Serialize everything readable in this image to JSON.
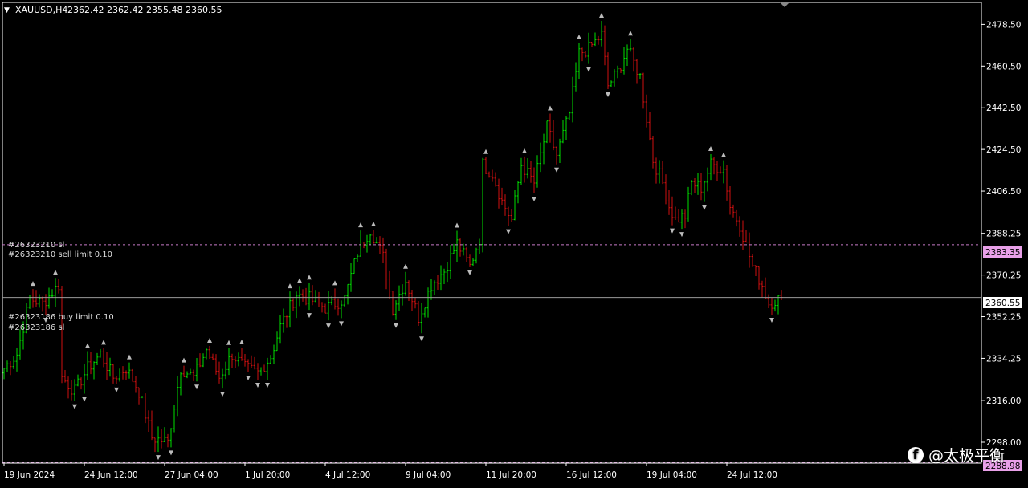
{
  "header": {
    "symbol": "XAUUSD,H4",
    "ohlc": "2362.42 2362.42 2355.48 2360.55"
  },
  "orders": [
    {
      "label": "#26323210 sl",
      "price": 2383.35
    },
    {
      "label": "#26323210 sell limit 0.10",
      "price": 2383.35
    },
    {
      "label": "#26323186 buy limit 0.10",
      "price": 2360.55
    },
    {
      "label": "#26323186 sl",
      "price": 2360.55
    }
  ],
  "price_tags": {
    "order_line": "2383.35",
    "bid_line": "2360.55",
    "bottom": "2288.98"
  },
  "watermark": {
    "icon": "facebook-icon",
    "text": "@太极平衡"
  },
  "colors": {
    "bull": "#00e000",
    "bear": "#d01010",
    "order_line": "#c87ac8",
    "bid_line": "#9a9a9a",
    "tag_pink": "#e8a0e8"
  },
  "chart_data": {
    "type": "candlestick",
    "symbol": "XAUUSD",
    "timeframe": "H4",
    "y_range": [
      2288.98,
      2488
    ],
    "y_ticks": [
      2298.0,
      2316.0,
      2334.25,
      2352.25,
      2370.25,
      2388.25,
      2406.5,
      2424.5,
      2442.5,
      2460.5,
      2478.5
    ],
    "y_tick_labels": [
      "2298.00",
      "2316.00",
      "2334.25",
      "2352.25",
      "2370.25",
      "2388.25",
      "2406.50",
      "2424.50",
      "2442.50",
      "2460.50",
      "2478.50"
    ],
    "x_labels": [
      "19 Jun 2024",
      "24 Jun 12:00",
      "27 Jun 04:00",
      "1 Jul 20:00",
      "4 Jul 12:00",
      "9 Jul 04:00",
      "11 Jul 20:00",
      "16 Jul 12:00",
      "19 Jul 04:00",
      "24 Jul 12:00"
    ],
    "x_label_index": [
      0,
      25,
      50,
      75,
      100,
      125,
      150,
      175,
      200,
      225
    ],
    "bar_count": 243,
    "anchor_prices": [
      [
        0,
        2330
      ],
      [
        4,
        2336
      ],
      [
        8,
        2360
      ],
      [
        12,
        2358
      ],
      [
        17,
        2366
      ],
      [
        18,
        2326
      ],
      [
        22,
        2320
      ],
      [
        26,
        2330
      ],
      [
        30,
        2336
      ],
      [
        34,
        2326
      ],
      [
        38,
        2330
      ],
      [
        42,
        2320
      ],
      [
        46,
        2300
      ],
      [
        51,
        2298
      ],
      [
        55,
        2330
      ],
      [
        59,
        2326
      ],
      [
        63,
        2338
      ],
      [
        67,
        2326
      ],
      [
        71,
        2336
      ],
      [
        75,
        2330
      ],
      [
        79,
        2328
      ],
      [
        83,
        2335
      ],
      [
        86,
        2348
      ],
      [
        91,
        2362
      ],
      [
        95,
        2360
      ],
      [
        100,
        2356
      ],
      [
        106,
        2360
      ],
      [
        110,
        2380
      ],
      [
        114,
        2390
      ],
      [
        118,
        2378
      ],
      [
        121,
        2356
      ],
      [
        125,
        2368
      ],
      [
        129,
        2352
      ],
      [
        133,
        2366
      ],
      [
        137,
        2372
      ],
      [
        141,
        2384
      ],
      [
        145,
        2374
      ],
      [
        148,
        2386
      ],
      [
        149,
        2418
      ],
      [
        152,
        2414
      ],
      [
        155,
        2402
      ],
      [
        158,
        2394
      ],
      [
        161,
        2418
      ],
      [
        165,
        2410
      ],
      [
        169,
        2434
      ],
      [
        172,
        2422
      ],
      [
        176,
        2440
      ],
      [
        179,
        2466
      ],
      [
        182,
        2468
      ],
      [
        186,
        2474
      ],
      [
        188,
        2452
      ],
      [
        191,
        2458
      ],
      [
        194,
        2468
      ],
      [
        198,
        2456
      ],
      [
        202,
        2420
      ],
      [
        205,
        2410
      ],
      [
        207,
        2400
      ],
      [
        209,
        2394
      ],
      [
        212,
        2396
      ],
      [
        214,
        2410
      ],
      [
        217,
        2408
      ],
      [
        220,
        2418
      ],
      [
        224,
        2416
      ],
      [
        226,
        2400
      ],
      [
        229,
        2392
      ],
      [
        233,
        2374
      ],
      [
        236,
        2366
      ],
      [
        238,
        2358
      ],
      [
        241,
        2360
      ],
      [
        242,
        2360.55
      ]
    ],
    "order_lines": [
      {
        "price": 2383.35,
        "style": "dashed"
      },
      {
        "price": 2360.55,
        "style": "solid"
      }
    ]
  }
}
